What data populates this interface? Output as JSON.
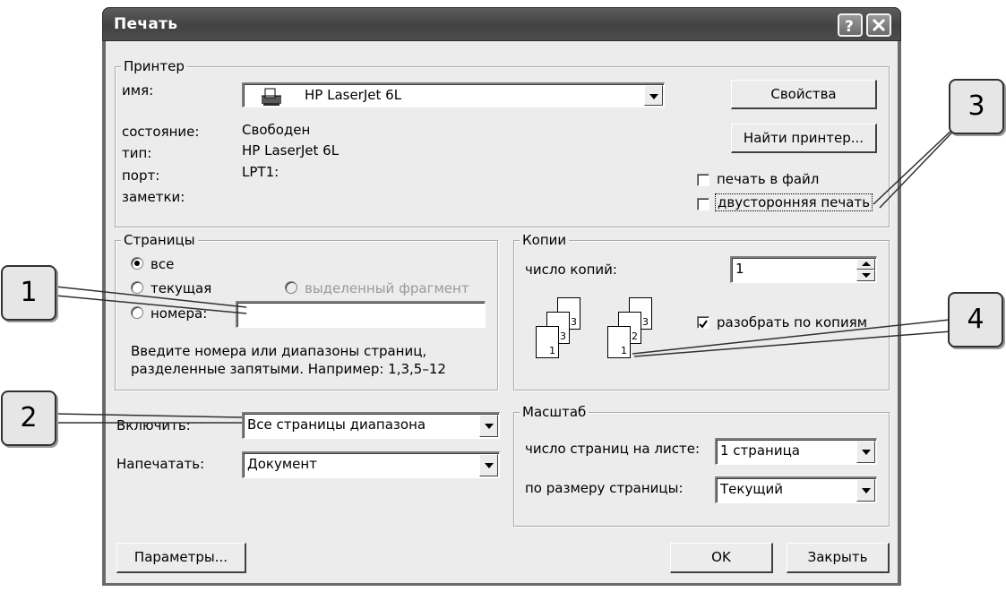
{
  "window": {
    "title": "Печать"
  },
  "printer": {
    "group_label": "Принтер",
    "name_label": "имя:",
    "name_value": "HP LaserJet 6L",
    "status_label": "состояние:",
    "status_value": "Свободен",
    "type_label": "тип:",
    "type_value": "HP LaserJet 6L",
    "port_label": "порт:",
    "port_value": "LPT1:",
    "notes_label": "заметки:",
    "properties_button": "Свойства",
    "find_printer_button": "Найти принтер...",
    "print_to_file_label": "печать в файл",
    "print_to_file_checked": false,
    "duplex_label": "двусторонняя печать",
    "duplex_checked": false
  },
  "pages": {
    "group_label": "Страницы",
    "all_label": "все",
    "current_label": "текущая",
    "selection_label": "выделенный фрагмент",
    "numbers_label": "номера:",
    "numbers_value": "",
    "selected": "all",
    "hint_line1": "Введите номера или диапазоны страниц,",
    "hint_line2": "разделенные запятыми. Например: 1,3,5–12"
  },
  "copies": {
    "group_label": "Копии",
    "count_label": "число копий:",
    "count_value": "1",
    "collate_label": "разобрать по копиям",
    "collate_checked": true,
    "page_numbers": [
      "3",
      "2",
      "1"
    ]
  },
  "include": {
    "label": "Включить:",
    "value": "Все страницы диапазона"
  },
  "print_what": {
    "label": "Напечатать:",
    "value": "Документ"
  },
  "zoom": {
    "group_label": "Масштаб",
    "pages_per_sheet_label": "число страниц на листе:",
    "pages_per_sheet_value": "1 страница",
    "scale_to_label": "по размеру страницы:",
    "scale_to_value": "Текущий"
  },
  "buttons": {
    "options": "Параметры...",
    "ok": "OK",
    "close": "Закрыть"
  },
  "callouts": [
    "1",
    "2",
    "3",
    "4"
  ]
}
